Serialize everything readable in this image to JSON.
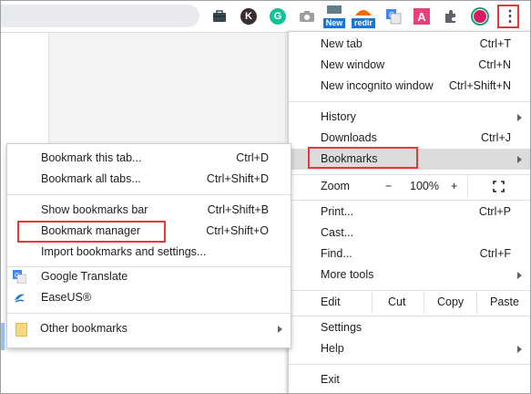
{
  "toolbar": {
    "extensions": [
      {
        "name": "briefcase-extension-icon",
        "label": ""
      },
      {
        "name": "k-extension-icon",
        "label": "K"
      },
      {
        "name": "grammarly-extension-icon",
        "label": "G"
      },
      {
        "name": "camera-extension-icon",
        "label": ""
      },
      {
        "name": "new-extension-icon",
        "label": "New"
      },
      {
        "name": "redir-extension-icon",
        "label": "redir"
      },
      {
        "name": "translate-extension-icon",
        "label": ""
      },
      {
        "name": "a-extension-icon",
        "label": "A"
      },
      {
        "name": "puzzle-extension-icon",
        "label": ""
      },
      {
        "name": "profile-avatar-icon",
        "label": ""
      },
      {
        "name": "kebab-menu-icon",
        "label": "⋮"
      }
    ]
  },
  "menu": {
    "new_tab": {
      "label": "New tab",
      "shortcut": "Ctrl+T"
    },
    "new_window": {
      "label": "New window",
      "shortcut": "Ctrl+N"
    },
    "new_incognito": {
      "label": "New incognito window",
      "shortcut": "Ctrl+Shift+N"
    },
    "history": {
      "label": "History"
    },
    "downloads": {
      "label": "Downloads",
      "shortcut": "Ctrl+J"
    },
    "bookmarks": {
      "label": "Bookmarks"
    },
    "zoom": {
      "label": "Zoom",
      "minus": "−",
      "value": "100%",
      "plus": "+"
    },
    "print": {
      "label": "Print...",
      "shortcut": "Ctrl+P"
    },
    "cast": {
      "label": "Cast..."
    },
    "find": {
      "label": "Find...",
      "shortcut": "Ctrl+F"
    },
    "more_tools": {
      "label": "More tools"
    },
    "edit": {
      "label": "Edit",
      "cut": "Cut",
      "copy": "Copy",
      "paste": "Paste"
    },
    "settings": {
      "label": "Settings"
    },
    "help": {
      "label": "Help"
    },
    "exit": {
      "label": "Exit"
    }
  },
  "bookmarks_menu": {
    "bookmark_tab": {
      "label": "Bookmark this tab...",
      "shortcut": "Ctrl+D"
    },
    "bookmark_all": {
      "label": "Bookmark all tabs...",
      "shortcut": "Ctrl+Shift+D"
    },
    "show_bar": {
      "label": "Show bookmarks bar",
      "shortcut": "Ctrl+Shift+B"
    },
    "manager": {
      "label": "Bookmark manager",
      "shortcut": "Ctrl+Shift+O"
    },
    "import": {
      "label": "Import bookmarks and settings..."
    },
    "google_translate": {
      "label": "Google Translate"
    },
    "easeus": {
      "label": "EaseUS®"
    },
    "other": {
      "label": "Other bookmarks"
    }
  },
  "colors": {
    "highlight_border": "#e53935",
    "hover_bg": "#dcdcdc",
    "avatar_ring": "#1a9e74",
    "avatar_fill": "#d81b60"
  }
}
